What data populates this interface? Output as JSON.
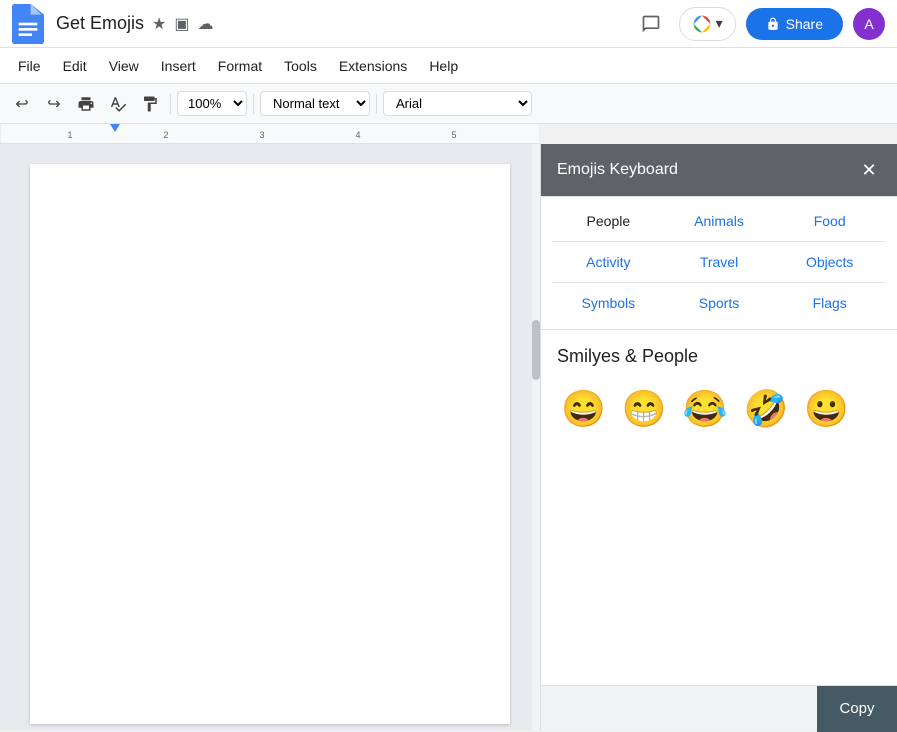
{
  "header": {
    "title": "Get Emojis",
    "star_icon": "★",
    "template_icon": "▣",
    "cloud_icon": "☁",
    "menus": [
      "File",
      "Edit",
      "View",
      "Insert",
      "Format",
      "Tools",
      "Extensions",
      "Help"
    ],
    "share_label": "Share",
    "avatar_letter": "A",
    "comment_icon": "💬",
    "lock_icon": "🔒"
  },
  "toolbar": {
    "undo_icon": "↩",
    "redo_icon": "↪",
    "print_icon": "🖨",
    "paint_icon": "✏",
    "copy_format_icon": "📋",
    "zoom_value": "100%",
    "style_value": "Normal text",
    "font_value": "Arial"
  },
  "emoji_panel": {
    "title": "Emojis Keyboard",
    "close_icon": "✕",
    "categories": {
      "row1": [
        "People",
        "Animals",
        "Food"
      ],
      "row2": [
        "Activity",
        "Travel",
        "Objects"
      ],
      "row3": [
        "Symbols",
        "Sports",
        "Flags"
      ]
    },
    "section_title": "Smilyes & People",
    "emojis": [
      "😄",
      "😁",
      "😂",
      "🤣",
      "😀"
    ],
    "copy_label": "Copy"
  }
}
